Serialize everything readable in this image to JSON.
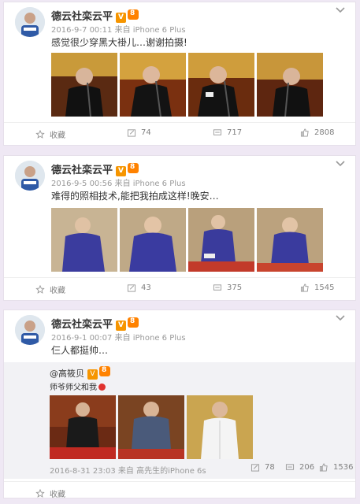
{
  "posts": [
    {
      "author": "德云社栾云平",
      "meta": "2016-9-7 00:11  来自 iPhone 6 Plus",
      "text": "感觉很少穿黑大褂儿…谢谢拍摄!",
      "footer": {
        "fav": "收藏",
        "repost": "74",
        "comment": "717",
        "like": "2808"
      }
    },
    {
      "author": "德云社栾云平",
      "meta": "2016-9-5 00:56  来自 iPhone 6 Plus",
      "text": "难得的照相技术,能把我拍成这样!晚安…",
      "footer": {
        "fav": "收藏",
        "repost": "43",
        "comment": "375",
        "like": "1545"
      }
    },
    {
      "author": "德云社栾云平",
      "meta": "2016-9-1 00:07  来自 iPhone 6 Plus",
      "text": "仨人都挺帅…",
      "repost": {
        "author": "@高筱贝",
        "text": "师爷师父和我",
        "meta": "2016-8-31 23:03  来自 高先生的iPhone 6s",
        "repost_count": "78",
        "comment_count": "206",
        "like_count": "1536"
      },
      "footer": {
        "fav": "收藏",
        "repost": "",
        "comment": "",
        "like": ""
      }
    }
  ],
  "colors": {
    "background": "#efe8f4",
    "badge": "#f69500",
    "heart": "#e0322e"
  }
}
